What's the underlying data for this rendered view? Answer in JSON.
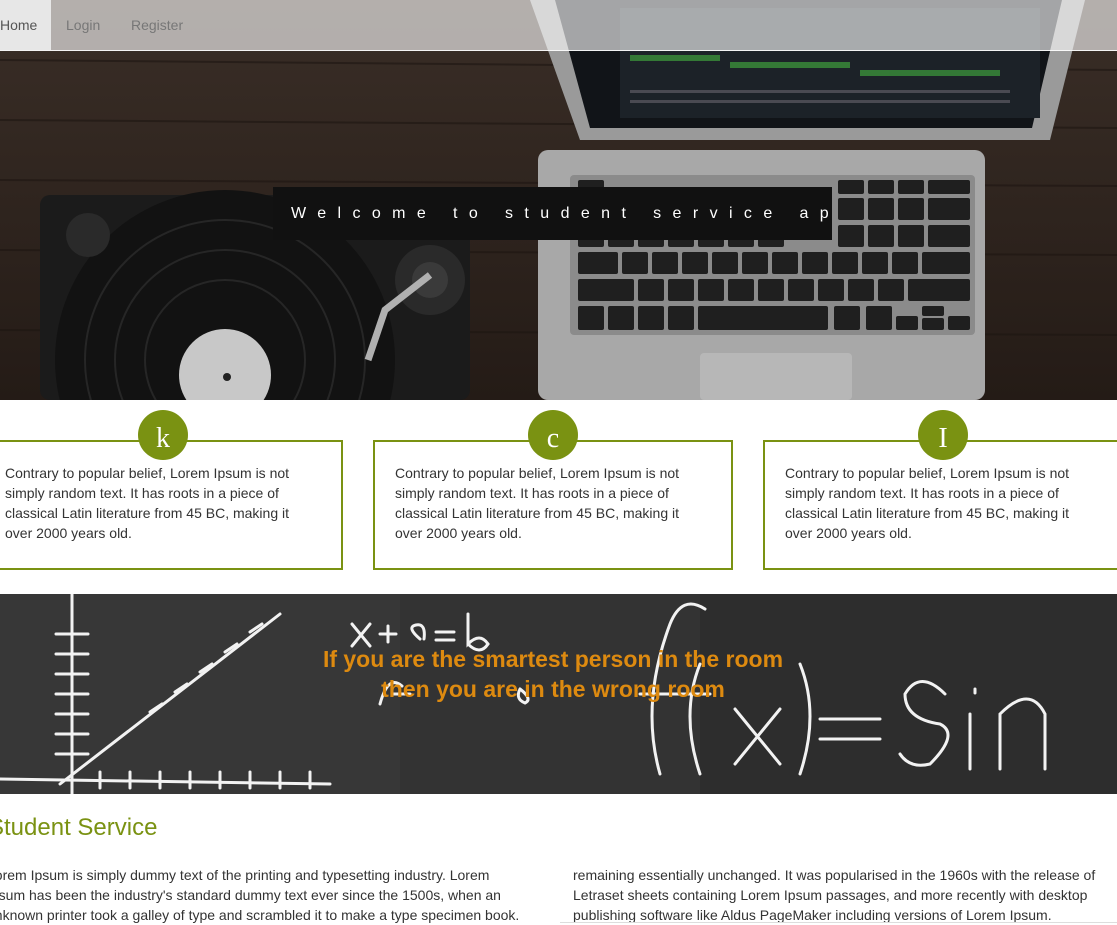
{
  "nav": {
    "items": [
      {
        "label": "Home",
        "active": true
      },
      {
        "label": "Login",
        "active": false
      },
      {
        "label": "Register",
        "active": false
      }
    ]
  },
  "hero": {
    "welcome": "Welcome to student service app!"
  },
  "features": [
    {
      "icon_letter": "k",
      "text": "Contrary to popular belief, Lorem Ipsum is not simply random text. It has roots in a piece of classical Latin literature from 45 BC, making it over 2000 years old."
    },
    {
      "icon_letter": "c",
      "text": "Contrary to popular belief, Lorem Ipsum is not simply random text. It has roots in a piece of classical Latin literature from 45 BC, making it over 2000 years old."
    },
    {
      "icon_letter": "I",
      "text": "Contrary to popular belief, Lorem Ipsum is not simply random text. It has roots in a piece of classical Latin literature from 45 BC, making it over 2000 years old."
    }
  ],
  "quote": {
    "line1": "If you are the smartest person in the room",
    "line2": "then you are in the wrong room"
  },
  "about": {
    "title": "Student Service",
    "col1": "Lorem Ipsum is simply dummy text of the printing and typesetting industry. Lorem Ipsum has been the industry's standard dummy text ever since the 1500s, when an unknown printer took a galley of type and scrambled it to make a type specimen book.",
    "col2": "remaining essentially unchanged. It was popularised in the 1960s with the release of Letraset sheets containing Lorem Ipsum passages, and more recently with desktop publishing software like Aldus PageMaker including versions of Lorem Ipsum."
  },
  "colors": {
    "accent_green": "#7a9212",
    "quote_orange": "#dd8a10",
    "welcome_bg": "#111111"
  }
}
